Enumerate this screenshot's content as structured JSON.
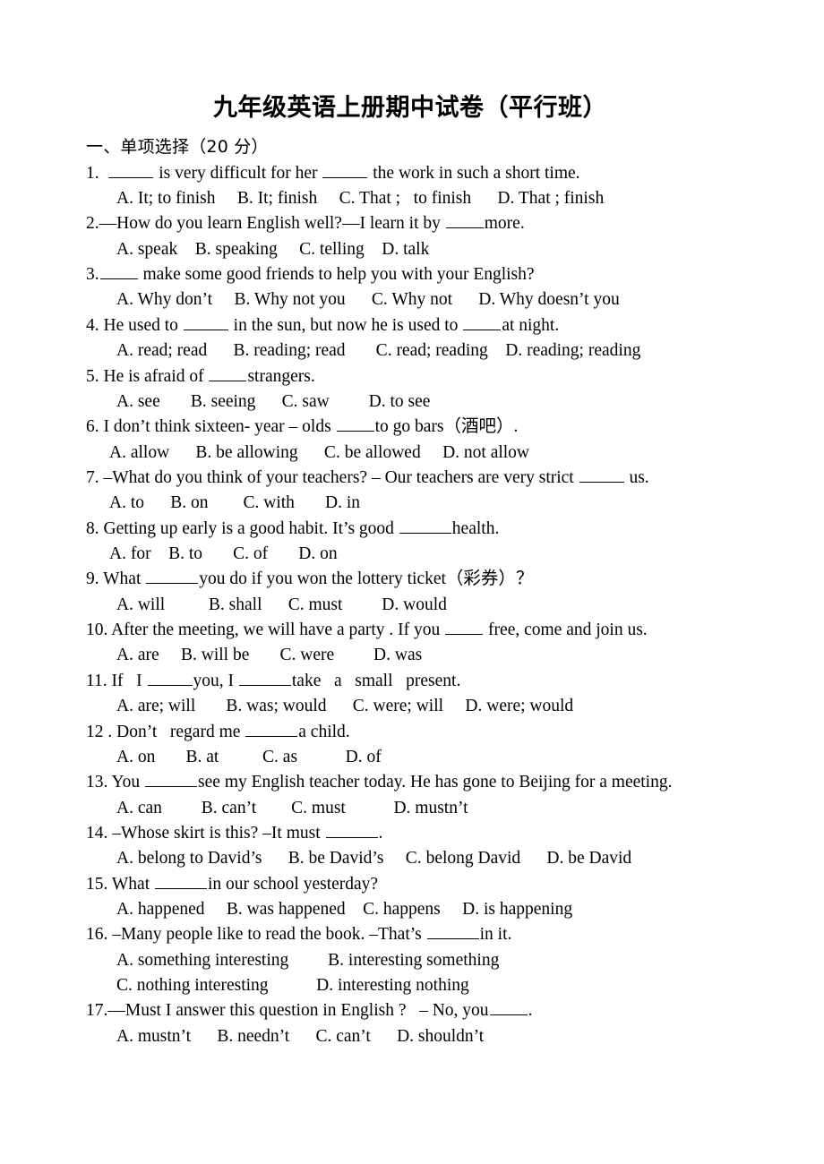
{
  "document": {
    "title": "九年级英语上册期中试卷（平行班）",
    "section_heading": "一、单项选择（20 分）"
  },
  "questions": [
    {
      "number": "1.",
      "stem_before": "1.  ",
      "stem_mid": " is very difficult for her ",
      "stem_after": " the work in such a short time.",
      "stem_text": "1.  _____ is very difficult for her _____ the work in such a short time.",
      "options_text": "A. It; to finish     B. It; finish     C. That ;   to finish      D. That ; finish",
      "options": [
        "A. It; to finish",
        "B. It; finish",
        "C. That ;   to finish",
        "D. That ; finish"
      ]
    },
    {
      "number": "2.",
      "stem_before": "2.—How do you learn English well?—I learn it by ",
      "stem_after": "more.",
      "stem_text": "2.—How do you learn English well?—I learn it by _____more.",
      "options_text": "A. speak    B. speaking     C. telling    D. talk",
      "options": [
        "A. speak",
        "B. speaking",
        "C. telling",
        "D. talk"
      ]
    },
    {
      "number": "3.",
      "stem_before": "3.",
      "stem_after": " make some good friends to help you with your English?",
      "stem_text": "3._____ make some good friends to help you with your English?",
      "options_text": "A. Why don’t     B. Why not you      C. Why not      D. Why doesn’t you",
      "options": [
        "A. Why don’t",
        "B. Why not you",
        "C. Why not",
        "D. Why doesn’t you"
      ]
    },
    {
      "number": "4.",
      "stem_before": "4. He used to ",
      "stem_mid": " in the sun, but now he is used to ",
      "stem_after": "at night.",
      "stem_text": "4. He used to _____ in the sun, but now he is used to _____at night.",
      "options_text": "A. read; read      B. reading; read       C. read; reading    D. reading; reading",
      "options": [
        "A. read; read",
        "B. reading; read",
        "C. read; reading",
        "D. reading; reading"
      ]
    },
    {
      "number": "5.",
      "stem_before": "5. He is afraid of ",
      "stem_after": "strangers.",
      "stem_text": "5. He is afraid of _____strangers.",
      "options_text": "A. see       B. seeing      C. saw         D. to see",
      "options": [
        "A. see",
        "B. seeing",
        "C. saw",
        "D. to see"
      ]
    },
    {
      "number": "6.",
      "stem_before": "6. I don’t think sixteen- year – olds ",
      "stem_after": "to go bars（酒吧）.",
      "stem_text": "6. I don’t think sixteen- year – olds _____to go bars（酒吧）.",
      "options_text": "A. allow      B. be allowing      C. be allowed     D. not allow",
      "options": [
        "A. allow",
        "B. be allowing",
        "C. be allowed",
        "D. not allow"
      ]
    },
    {
      "number": "7.",
      "stem_before": "7. –What do you think of your teachers? – Our teachers are very strict ",
      "stem_after": " us.",
      "stem_text": "7. –What do you think of your teachers? – Our teachers are very strict _____ us.",
      "options_text": "A. to      B. on        C. with       D. in",
      "options": [
        "A. to",
        "B. on",
        "C. with",
        "D. in"
      ]
    },
    {
      "number": "8.",
      "stem_before": "8. Getting up early is a good habit. It’s good ",
      "stem_after": "health.",
      "stem_text": "8. Getting up early is a good habit. It’s good ______health.",
      "options_text": "A. for    B. to       C. of       D. on",
      "options": [
        "A. for",
        "B. to",
        "C. of",
        "D. on"
      ]
    },
    {
      "number": "9.",
      "stem_before": "9. What ",
      "stem_after": "you do if you won the lottery ticket（彩券）？",
      "stem_text": "9. What ______you do if you won the lottery ticket（彩券）？",
      "options_text": "A. will          B. shall      C. must         D. would",
      "options": [
        "A. will",
        "B. shall",
        "C. must",
        "D. would"
      ]
    },
    {
      "number": "10.",
      "stem_before": "10. After the meeting, we will have a party . If you ",
      "stem_after": " free, come and join us.",
      "stem_text": "10. After the meeting, we will have a party . If you ____ free, come and join us.",
      "options_text": "A. are     B. will be       C. were         D. was",
      "options": [
        "A. are",
        "B. will be",
        "C. were",
        "D. was"
      ]
    },
    {
      "number": "11.",
      "stem_before": "11. If   I ",
      "stem_mid": "you, I ",
      "stem_after": "take   a   small   present.",
      "stem_text": "11. If   I _____you, I ______take   a   small   present.",
      "options_text": "A. are; will       B. was; would      C. were; will     D. were; would",
      "options": [
        "A. are; will",
        "B. was; would",
        "C. were; will",
        "D. were; would"
      ]
    },
    {
      "number": "12.",
      "stem_before": "12 . Don’t   regard me ",
      "stem_after": "a child.",
      "stem_text": "12 . Don’t   regard me ______a child.",
      "options_text": "A. on       B. at          C. as           D. of",
      "options": [
        "A. on",
        "B. at",
        "C. as",
        "D. of"
      ]
    },
    {
      "number": "13.",
      "stem_before": "13. You ",
      "stem_after": "see my English teacher today. He has gone to Beijing for a meeting.",
      "stem_text": "13. You ______see my English teacher today. He has gone to Beijing for a meeting.",
      "options_text": "A. can         B. can’t        C. must           D. mustn’t",
      "options": [
        "A. can",
        "B. can’t",
        "C. must",
        "D. mustn’t"
      ]
    },
    {
      "number": "14.",
      "stem_before": "14. –Whose skirt is this? –It must ",
      "stem_after": ".",
      "stem_text": "14. –Whose skirt is this? –It must ______.",
      "options_text": "A. belong to David’s      B. be David’s     C. belong David      D. be David",
      "options": [
        "A. belong to David’s",
        "B. be David’s",
        "C. belong David",
        "D. be David"
      ]
    },
    {
      "number": "15.",
      "stem_before": "15. What ",
      "stem_after": "in our school yesterday?",
      "stem_text": "15. What ______in our school yesterday?",
      "options_text": "A. happened     B. was happened    C. happens     D. is happening",
      "options": [
        "A. happened",
        "B. was happened",
        "C. happens",
        "D. is happening"
      ]
    },
    {
      "number": "16.",
      "stem_before": "16. –Many people like to read the book. –That’s ",
      "stem_after": "in it.",
      "stem_text": "16. –Many people like to read the book. –That’s ______in it.",
      "options_text": "A. something interesting         B. interesting something",
      "options_text2": "C. nothing interesting           D. interesting nothing",
      "options": [
        "A. something interesting",
        "B. interesting something",
        "C. nothing interesting",
        "D. interesting nothing"
      ]
    },
    {
      "number": "17.",
      "stem_before": "17.—Must I answer this question in English ?   – No, you",
      "stem_after": ".",
      "stem_text": "17.—Must I answer this question in English ?   – No, you_____.",
      "options_text": "A. mustn’t      B. needn’t      C. can’t      D. shouldn’t",
      "options": [
        "A. mustn’t",
        "B. needn’t",
        "C. can’t",
        "D. shouldn’t"
      ]
    }
  ]
}
